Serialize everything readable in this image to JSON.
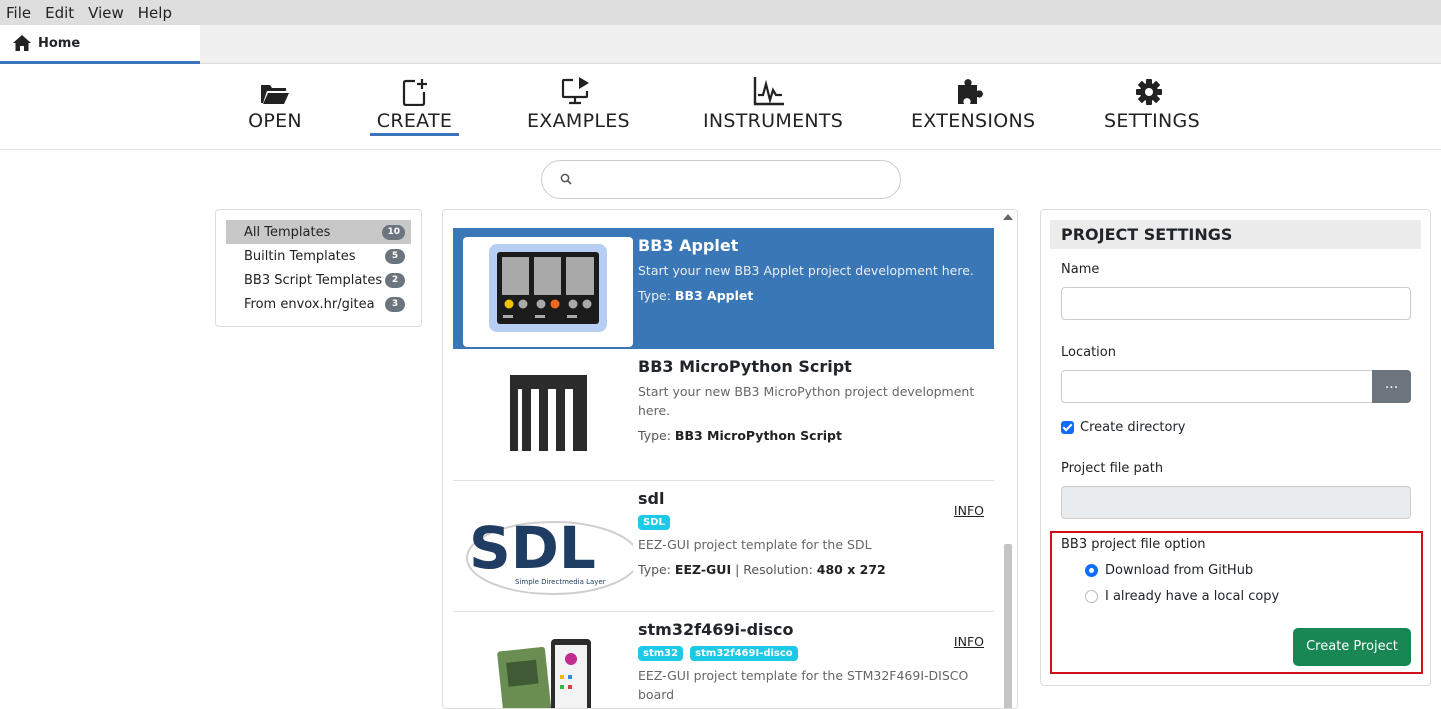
{
  "menubar": {
    "items": [
      "File",
      "Edit",
      "View",
      "Help"
    ]
  },
  "tabs": {
    "home": "Home"
  },
  "nav": {
    "items": [
      {
        "label": "OPEN",
        "icon": "folder-open-icon"
      },
      {
        "label": "CREATE",
        "icon": "file-plus-icon"
      },
      {
        "label": "EXAMPLES",
        "icon": "monitor-play-icon"
      },
      {
        "label": "INSTRUMENTS",
        "icon": "pulse-chart-icon"
      },
      {
        "label": "EXTENSIONS",
        "icon": "puzzle-icon"
      },
      {
        "label": "SETTINGS",
        "icon": "gear-icon"
      }
    ],
    "active": "CREATE"
  },
  "search": {
    "placeholder": ""
  },
  "categories": [
    {
      "label": "All Templates",
      "count": "10"
    },
    {
      "label": "Builtin Templates",
      "count": "5"
    },
    {
      "label": "BB3 Script Templates",
      "count": "2"
    },
    {
      "label": "From envox.hr/gitea",
      "count": "3"
    }
  ],
  "templates": [
    {
      "title": "BB3 Applet",
      "desc": "Start your new BB3 Applet project development here.",
      "type_label": "Type:",
      "type": "BB3 Applet"
    },
    {
      "title": "BB3 MicroPython Script",
      "desc": "Start your new BB3 MicroPython project development here.",
      "type_label": "Type:",
      "type": "BB3 MicroPython Script"
    },
    {
      "title": "sdl",
      "tags": [
        "SDL"
      ],
      "desc": "EEZ-GUI project template for the SDL",
      "type_label": "Type:",
      "type": "EEZ-GUI",
      "res_label": "| Resolution:",
      "resolution": "480 x 272",
      "info": "INFO",
      "logo_text": "SDL",
      "logo_sub": "Simple Directmedia Layer"
    },
    {
      "title": "stm32f469i-disco",
      "tags": [
        "stm32",
        "stm32f469I-disco"
      ],
      "desc": "EEZ-GUI project template for the STM32F469I-DISCO board",
      "info": "INFO"
    }
  ],
  "settings": {
    "header": "PROJECT SETTINGS",
    "name_label": "Name",
    "location_label": "Location",
    "browse": "...",
    "create_dir": "Create directory",
    "path_label": "Project file path",
    "option_label": "BB3 project file option",
    "option1": "Download from GitHub",
    "option2": "I already have a local copy",
    "create_button": "Create Project"
  },
  "colors": {
    "accent": "#3b73b9",
    "selected": "#3a77b6",
    "success": "#198754",
    "highlight": "#d0101a"
  }
}
